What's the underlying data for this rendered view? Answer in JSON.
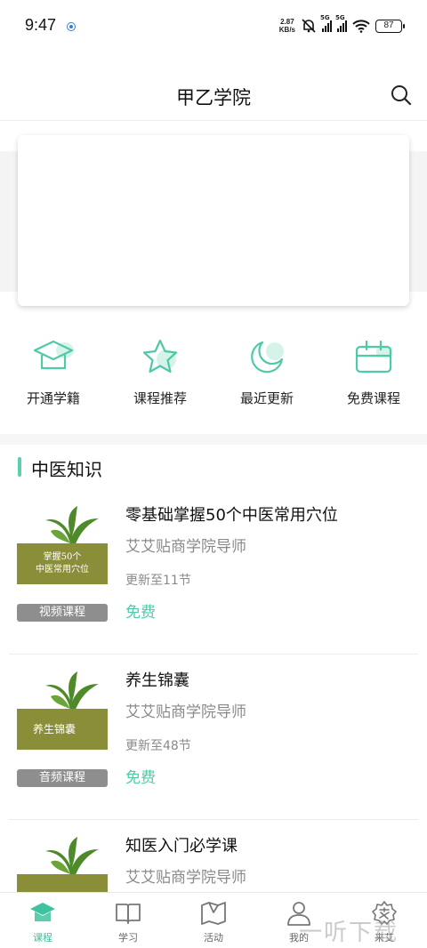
{
  "status_bar": {
    "time": "9:47",
    "net_speed_value": "2.87",
    "net_speed_unit": "KB/s",
    "signal_1_tag": "5G",
    "signal_2_tag": "5G",
    "battery": "87"
  },
  "header": {
    "title": "甲乙学院",
    "search_icon": "search-icon"
  },
  "quick_entries": [
    {
      "label": "开通学籍",
      "icon": "graduation-cap-icon"
    },
    {
      "label": "课程推荐",
      "icon": "star-icon"
    },
    {
      "label": "最近更新",
      "icon": "moon-icon"
    },
    {
      "label": "免费课程",
      "icon": "calendar-icon"
    }
  ],
  "section": {
    "title": "中医知识"
  },
  "courses": [
    {
      "title": "零基础掌握50个中医常用穴位",
      "author": "艾艾贴商学院导师",
      "update": "更新至11节",
      "price": "免费",
      "tag": "视频课程",
      "thumb_line1": "掌握50个",
      "thumb_line2": "中医常用穴位"
    },
    {
      "title": "养生锦囊",
      "author": "艾艾贴商学院导师",
      "update": "更新至48节",
      "price": "免费",
      "tag": "音频课程",
      "thumb_line1": "养生锦囊",
      "thumb_line2": ""
    },
    {
      "title": "知医入门必学课",
      "author": "艾艾贴商学院导师",
      "update": "",
      "price": "",
      "tag": "",
      "thumb_line1": "",
      "thumb_line2": ""
    }
  ],
  "bottom_nav": [
    {
      "label": "课程",
      "icon": "graduation-cap-icon",
      "active": true
    },
    {
      "label": "学习",
      "icon": "book-icon",
      "active": false
    },
    {
      "label": "活动",
      "icon": "map-icon",
      "active": false
    },
    {
      "label": "我的",
      "icon": "user-icon",
      "active": false
    },
    {
      "label": "来艾",
      "icon": "ai-logo-icon",
      "active": false
    }
  ],
  "watermark": "一听下载",
  "colors": {
    "accent": "#4fcaa8",
    "thumb_olive": "#8b8e38",
    "tag_grey": "#8e8e8e"
  }
}
